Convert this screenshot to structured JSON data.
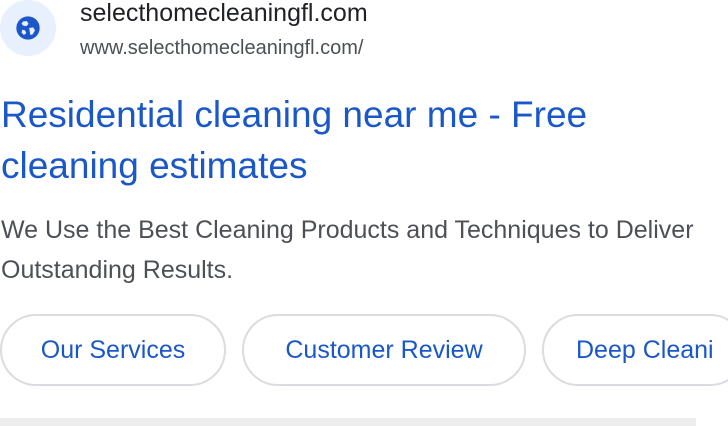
{
  "result": {
    "site_name": "selecthomecleaningfl.com",
    "site_url": "www.selecthomecleaningfl.com/",
    "favicon_icon": "globe-icon",
    "title": "Residential cleaning near me - Free cleaning estimates",
    "snippet": "We Use the Best Cleaning Products and Techniques to Deliver Outstanding Results.",
    "sitelinks": [
      {
        "label": "Our Services"
      },
      {
        "label": "Customer Review"
      },
      {
        "label": "Deep Cleani"
      }
    ]
  },
  "colors": {
    "link_blue": "#1a57c9",
    "favicon_bg": "#e8f0fe",
    "chip_border": "#dadce0"
  }
}
